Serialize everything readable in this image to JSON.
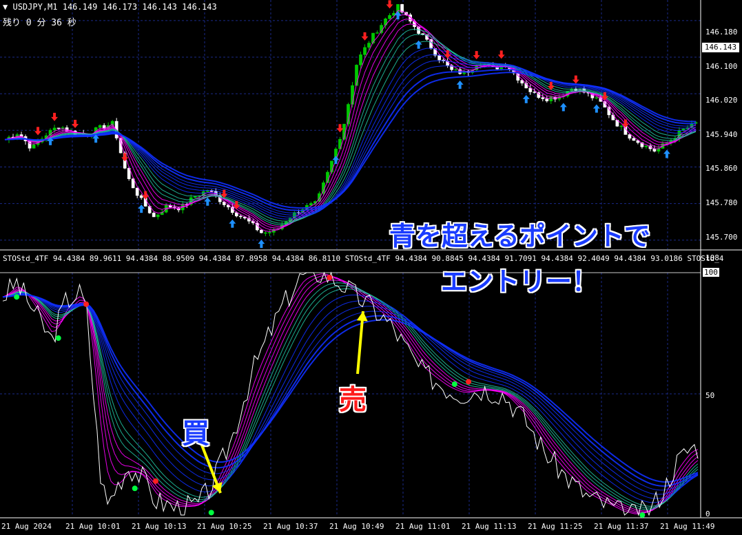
{
  "header": {
    "symbol": "USDJPY,M1",
    "ohlc": "146.149 146.173 146.143 146.143",
    "timer": "残り 0 分 36 秒",
    "indicator_line": "STOStd_4TF 94.4384 89.9611 94.4384 88.9509 94.4384 87.8958 94.4384 86.8110   STOStd_4TF 94.4384 90.8845 94.4384 91.7091 94.4384 92.4049 94.4384 93.0186   STOStd_4"
  },
  "colors": {
    "bull": "#00c800",
    "bear": "#ffffff",
    "grid": "#1a2a8a",
    "ma_fast": "#ff00ff",
    "ma_mid": "#20c0a0",
    "ma_slow": "#1030ff",
    "buy_arrow": "#1e90ff",
    "sell_arrow": "#ff2020",
    "dot_up": "#00ff40",
    "dot_down": "#ff2020"
  },
  "price_axis": {
    "ticks": [
      "146.180",
      "146.100",
      "146.020",
      "145.940",
      "145.860",
      "145.780",
      "145.700"
    ],
    "current": "146.143"
  },
  "osc_axis": {
    "ticks": [
      "108",
      "100",
      "50",
      "0"
    ]
  },
  "x_axis": {
    "ticks": [
      "21 Aug 2024",
      "21 Aug 10:01",
      "21 Aug 10:13",
      "21 Aug 10:25",
      "21 Aug 10:37",
      "21 Aug 10:49",
      "21 Aug 11:01",
      "21 Aug 11:13",
      "21 Aug 11:25",
      "21 Aug 11:37",
      "21 Aug 11:49"
    ]
  },
  "annotations": {
    "headline_1": "青を超えるポイントで",
    "headline_2": "エントリー！",
    "buy_label": "買",
    "sell_label": "売"
  },
  "chart_data": [
    {
      "type": "candlestick",
      "symbol": "USDJPY",
      "timeframe": "M1",
      "ylim": [
        145.68,
        146.225
      ],
      "anchor_closes": [
        145.92,
        145.935,
        145.9,
        145.93,
        145.95,
        145.935,
        145.93,
        145.945,
        145.955,
        145.84,
        145.79,
        145.75,
        145.775,
        145.77,
        145.795,
        145.81,
        145.785,
        145.76,
        145.74,
        145.715,
        145.72,
        145.75,
        145.77,
        145.78,
        145.86,
        145.95,
        146.09,
        146.14,
        146.18,
        146.21,
        146.175,
        146.14,
        146.1,
        146.07,
        146.065,
        146.09,
        146.075,
        146.085,
        146.05,
        146.02,
        146.01,
        146.015,
        146.035,
        146.02,
        146.0,
        145.96,
        145.93,
        145.91,
        145.895,
        145.915,
        145.94,
        145.955
      ],
      "last_price": 146.143
    },
    {
      "type": "line",
      "name": "STOStd_4TF",
      "ylim": [
        0,
        108
      ],
      "x_index_range": [
        0,
        100
      ],
      "stochastic_anchors": [
        [
          0,
          90
        ],
        [
          2,
          96
        ],
        [
          5,
          82
        ],
        [
          7,
          72
        ],
        [
          9,
          88
        ],
        [
          11,
          92
        ],
        [
          12,
          86
        ],
        [
          14,
          18
        ],
        [
          15,
          4
        ],
        [
          16,
          10
        ],
        [
          18,
          20
        ],
        [
          20,
          16
        ],
        [
          22,
          6
        ],
        [
          25,
          3
        ],
        [
          28,
          4
        ],
        [
          30,
          12
        ],
        [
          33,
          32
        ],
        [
          36,
          60
        ],
        [
          40,
          85
        ],
        [
          43,
          99
        ],
        [
          46,
          100
        ],
        [
          49,
          95
        ],
        [
          51,
          90
        ],
        [
          53,
          86
        ],
        [
          56,
          78
        ],
        [
          60,
          60
        ],
        [
          62,
          56
        ],
        [
          64,
          52
        ],
        [
          66,
          50
        ],
        [
          69,
          52
        ],
        [
          72,
          50
        ],
        [
          75,
          40
        ],
        [
          78,
          26
        ],
        [
          81,
          16
        ],
        [
          84,
          8
        ],
        [
          87,
          4
        ],
        [
          89,
          1
        ],
        [
          91,
          0
        ],
        [
          93,
          2
        ],
        [
          95,
          10
        ],
        [
          97,
          22
        ],
        [
          99,
          28
        ]
      ],
      "signal_dots": [
        {
          "i": 2,
          "v": 90,
          "color": "dot_up"
        },
        {
          "i": 8,
          "v": 73,
          "color": "dot_up"
        },
        {
          "i": 12,
          "v": 87,
          "color": "dot_down"
        },
        {
          "i": 19,
          "v": 11,
          "color": "dot_up"
        },
        {
          "i": 22,
          "v": 14,
          "color": "dot_down"
        },
        {
          "i": 30,
          "v": 1,
          "color": "dot_up"
        },
        {
          "i": 47,
          "v": 98,
          "color": "dot_down"
        },
        {
          "i": 65,
          "v": 54,
          "color": "dot_up"
        },
        {
          "i": 67,
          "v": 55,
          "color": "dot_down"
        },
        {
          "i": 92,
          "v": 0,
          "color": "dot_up"
        }
      ]
    }
  ]
}
